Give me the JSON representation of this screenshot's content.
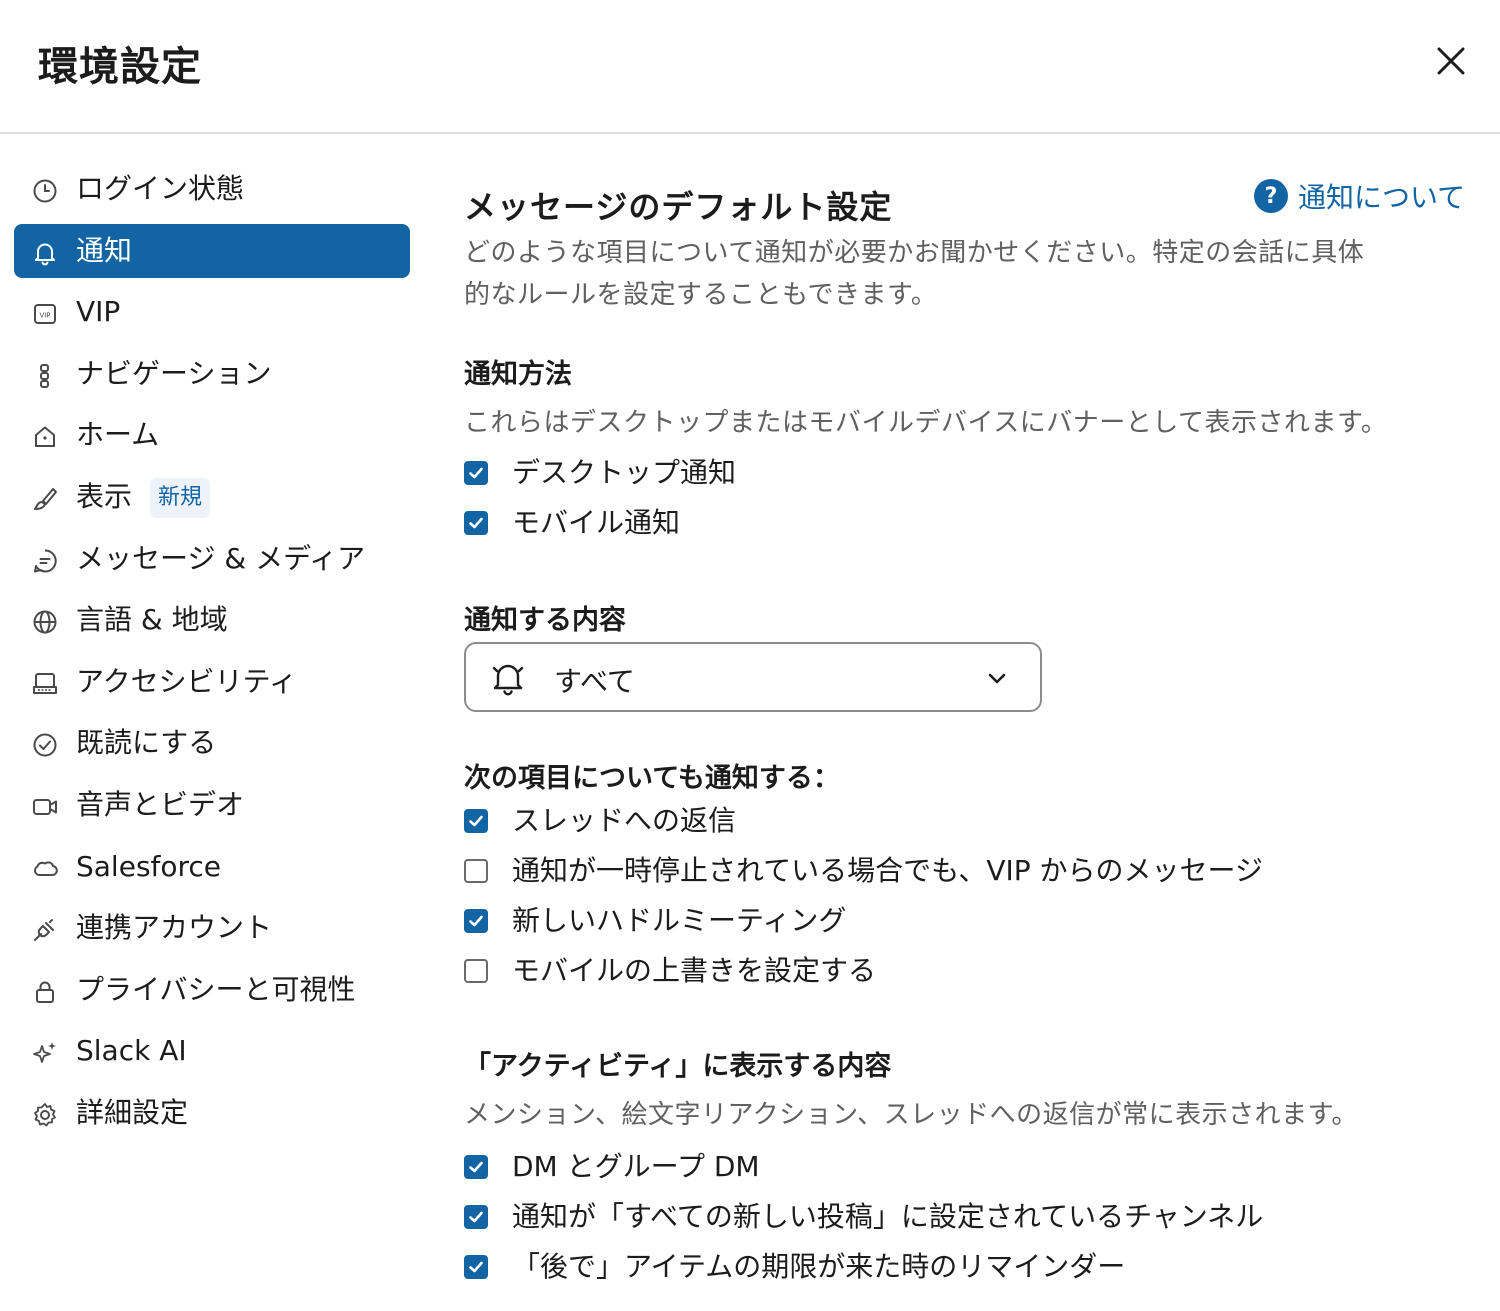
{
  "header": {
    "title": "環境設定"
  },
  "sidebar": {
    "items": [
      {
        "label": "ログイン状態",
        "icon": "clock-icon"
      },
      {
        "label": "通知",
        "icon": "bell-icon",
        "active": true
      },
      {
        "label": "VIP",
        "icon": "vip-icon"
      },
      {
        "label": "ナビゲーション",
        "icon": "navigation-icon"
      },
      {
        "label": "ホーム",
        "icon": "home-icon"
      },
      {
        "label": "表示",
        "icon": "brush-icon",
        "badge": "新規"
      },
      {
        "label": "メッセージ & メディア",
        "icon": "message-icon"
      },
      {
        "label": "言語 & 地域",
        "icon": "globe-icon"
      },
      {
        "label": "アクセシビリティ",
        "icon": "keyboard-icon"
      },
      {
        "label": "既読にする",
        "icon": "check-circle-icon"
      },
      {
        "label": "音声とビデオ",
        "icon": "video-icon"
      },
      {
        "label": "Salesforce",
        "icon": "cloud-icon"
      },
      {
        "label": "連携アカウント",
        "icon": "plug-icon"
      },
      {
        "label": "プライバシーと可視性",
        "icon": "lock-icon"
      },
      {
        "label": "Slack AI",
        "icon": "sparkle-icon"
      },
      {
        "label": "詳細設定",
        "icon": "gear-icon"
      }
    ]
  },
  "main": {
    "title": "メッセージのデフォルト設定",
    "help_link": "通知について",
    "description_line1": "どのような項目について通知が必要かお聞かせください。特定の会話に具体",
    "description_line2": "的なルールを設定することもできます。",
    "method": {
      "title": "通知方法",
      "description": "これらはデスクトップまたはモバイルデバイスにバナーとして表示されます。",
      "options": [
        {
          "label": "デスクトップ通知",
          "checked": true
        },
        {
          "label": "モバイル通知",
          "checked": true
        }
      ]
    },
    "content": {
      "title": "通知する内容",
      "selected": "すべて"
    },
    "also": {
      "title": "次の項目についても通知する：",
      "options": [
        {
          "label": "スレッドへの返信",
          "checked": true
        },
        {
          "label": "通知が一時停止されている場合でも、VIP からのメッセージ",
          "checked": false
        },
        {
          "label": "新しいハドルミーティング",
          "checked": true
        },
        {
          "label": "モバイルの上書きを設定する",
          "checked": false
        }
      ]
    },
    "activity": {
      "title": "「アクティビティ」に表示する内容",
      "description": "メンション、絵文字リアクション、スレッドへの返信が常に表示されます。",
      "options": [
        {
          "label": "DM とグループ DM",
          "checked": true
        },
        {
          "label": "通知が「すべての新しい投稿」に設定されているチャンネル",
          "checked": true
        },
        {
          "label": "「後で」アイテムの期限が来た時のリマインダー",
          "checked": true
        }
      ]
    }
  },
  "colors": {
    "accent": "#1264a3",
    "text": "#1d1c1d",
    "muted": "#616061",
    "divider": "#dddddd"
  }
}
